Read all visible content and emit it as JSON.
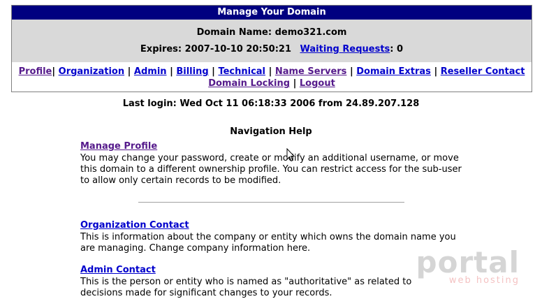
{
  "header": {
    "title": "Manage Your Domain",
    "domain_label": "Domain Name: demo321.com",
    "expires_label": "Expires: 2007-10-10 20:50:21",
    "waiting_link": "Waiting Requests",
    "waiting_count": ": 0"
  },
  "nav": {
    "items": [
      {
        "label": "Profile"
      },
      {
        "label": "Organization"
      },
      {
        "label": "Admin"
      },
      {
        "label": "Billing"
      },
      {
        "label": "Technical"
      },
      {
        "label": "Name Servers"
      },
      {
        "label": "Domain Extras"
      },
      {
        "label": "Reseller Contact"
      },
      {
        "label": "Domain Locking"
      },
      {
        "label": "Logout"
      }
    ]
  },
  "last_login": "Last login: Wed Oct 11 06:18:33 2006 from 24.89.207.128",
  "help": {
    "title": "Navigation Help",
    "sections": [
      {
        "link": "Manage Profile",
        "text": "You may change your password, create or modify an additional username, or move this domain to a different ownership profile. You can restrict access for the sub-user to allow only certain records to be modified."
      },
      {
        "link": "Organization Contact",
        "text": "This is information about the company or entity which owns the domain name you are managing. Change company information here."
      },
      {
        "link": "Admin Contact",
        "text": "This is the person or entity who is named as \"authoritative\" as related to decisions made for significant changes to your records."
      }
    ]
  },
  "watermark": {
    "brand": "portal",
    "tagline": "web hosting"
  }
}
